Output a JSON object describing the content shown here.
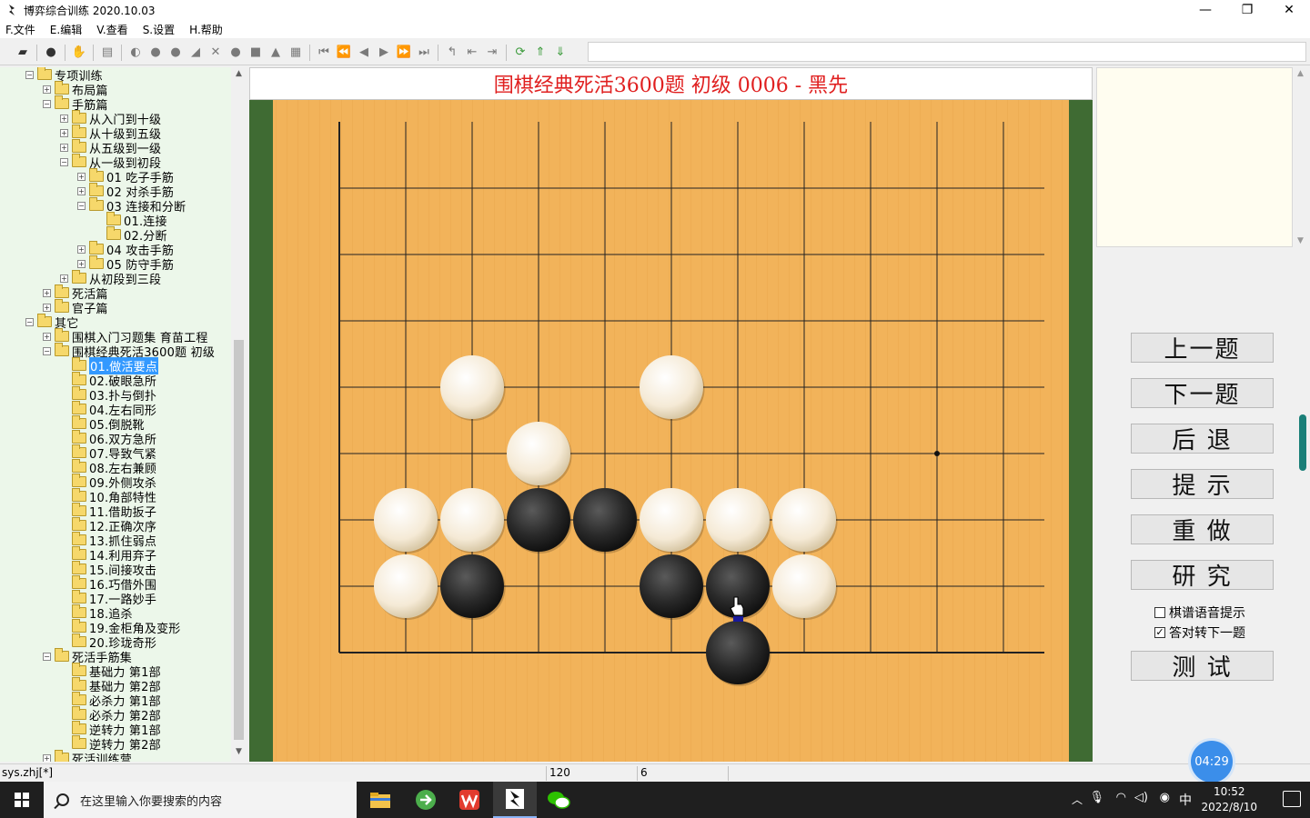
{
  "window": {
    "title": "博弈综合训练 2020.10.03",
    "controls": [
      "—",
      "❐",
      "✕"
    ]
  },
  "menu": [
    "F.文件",
    "E.编辑",
    "V.查看",
    "S.设置",
    "H.帮助"
  ],
  "tree": [
    {
      "indent": 0,
      "exp": "−",
      "label": "专项训练",
      "sel": false
    },
    {
      "indent": 1,
      "exp": "+",
      "label": "布局篇",
      "sel": false
    },
    {
      "indent": 1,
      "exp": "−",
      "label": "手筋篇",
      "sel": false
    },
    {
      "indent": 2,
      "exp": "+",
      "label": "从入门到十级",
      "sel": false
    },
    {
      "indent": 2,
      "exp": "+",
      "label": "从十级到五级",
      "sel": false
    },
    {
      "indent": 2,
      "exp": "+",
      "label": "从五级到一级",
      "sel": false
    },
    {
      "indent": 2,
      "exp": "−",
      "label": "从一级到初段",
      "sel": false
    },
    {
      "indent": 3,
      "exp": "+",
      "label": "01 吃子手筋",
      "sel": false
    },
    {
      "indent": 3,
      "exp": "+",
      "label": "02 对杀手筋",
      "sel": false
    },
    {
      "indent": 3,
      "exp": "−",
      "label": "03 连接和分断",
      "sel": false
    },
    {
      "indent": 4,
      "exp": "",
      "label": "01.连接",
      "sel": false
    },
    {
      "indent": 4,
      "exp": "",
      "label": "02.分断",
      "sel": false
    },
    {
      "indent": 3,
      "exp": "+",
      "label": "04 攻击手筋",
      "sel": false
    },
    {
      "indent": 3,
      "exp": "+",
      "label": "05 防守手筋",
      "sel": false
    },
    {
      "indent": 2,
      "exp": "+",
      "label": "从初段到三段",
      "sel": false
    },
    {
      "indent": 1,
      "exp": "+",
      "label": "死活篇",
      "sel": false
    },
    {
      "indent": 1,
      "exp": "+",
      "label": "官子篇",
      "sel": false
    },
    {
      "indent": 0,
      "exp": "−",
      "label": "其它",
      "sel": false
    },
    {
      "indent": 1,
      "exp": "+",
      "label": "围棋入门习题集 育苗工程",
      "sel": false
    },
    {
      "indent": 1,
      "exp": "−",
      "label": "围棋经典死活3600题 初级",
      "sel": false
    },
    {
      "indent": 2,
      "exp": "",
      "label": "01.做活要点",
      "sel": true
    },
    {
      "indent": 2,
      "exp": "",
      "label": "02.破眼急所",
      "sel": false
    },
    {
      "indent": 2,
      "exp": "",
      "label": "03.扑与倒扑",
      "sel": false
    },
    {
      "indent": 2,
      "exp": "",
      "label": "04.左右同形",
      "sel": false
    },
    {
      "indent": 2,
      "exp": "",
      "label": "05.倒脱靴",
      "sel": false
    },
    {
      "indent": 2,
      "exp": "",
      "label": "06.双方急所",
      "sel": false
    },
    {
      "indent": 2,
      "exp": "",
      "label": "07.导致气紧",
      "sel": false
    },
    {
      "indent": 2,
      "exp": "",
      "label": "08.左右兼顾",
      "sel": false
    },
    {
      "indent": 2,
      "exp": "",
      "label": "09.外侧攻杀",
      "sel": false
    },
    {
      "indent": 2,
      "exp": "",
      "label": "10.角部特性",
      "sel": false
    },
    {
      "indent": 2,
      "exp": "",
      "label": "11.借助扳子",
      "sel": false
    },
    {
      "indent": 2,
      "exp": "",
      "label": "12.正确次序",
      "sel": false
    },
    {
      "indent": 2,
      "exp": "",
      "label": "13.抓住弱点",
      "sel": false
    },
    {
      "indent": 2,
      "exp": "",
      "label": "14.利用弃子",
      "sel": false
    },
    {
      "indent": 2,
      "exp": "",
      "label": "15.间接攻击",
      "sel": false
    },
    {
      "indent": 2,
      "exp": "",
      "label": "16.巧借外围",
      "sel": false
    },
    {
      "indent": 2,
      "exp": "",
      "label": "17.一路妙手",
      "sel": false
    },
    {
      "indent": 2,
      "exp": "",
      "label": "18.追杀",
      "sel": false
    },
    {
      "indent": 2,
      "exp": "",
      "label": "19.金柜角及变形",
      "sel": false
    },
    {
      "indent": 2,
      "exp": "",
      "label": "20.珍珑奇形",
      "sel": false
    },
    {
      "indent": 1,
      "exp": "−",
      "label": "死活手筋集",
      "sel": false
    },
    {
      "indent": 2,
      "exp": "",
      "label": "基础力 第1部",
      "sel": false
    },
    {
      "indent": 2,
      "exp": "",
      "label": "基础力 第2部",
      "sel": false
    },
    {
      "indent": 2,
      "exp": "",
      "label": "必杀力 第1部",
      "sel": false
    },
    {
      "indent": 2,
      "exp": "",
      "label": "必杀力 第2部",
      "sel": false
    },
    {
      "indent": 2,
      "exp": "",
      "label": "逆转力 第1部",
      "sel": false
    },
    {
      "indent": 2,
      "exp": "",
      "label": "逆转力 第2部",
      "sel": false
    },
    {
      "indent": 1,
      "exp": "+",
      "label": "死活训练营",
      "sel": false
    }
  ],
  "board": {
    "title": "围棋经典死活3600题 初级 0006 - 黑先",
    "columns": 11,
    "rows": 9,
    "stones": [
      {
        "col": 2,
        "row": 4,
        "color": "white"
      },
      {
        "col": 5,
        "row": 4,
        "color": "white"
      },
      {
        "col": 3,
        "row": 5,
        "color": "white"
      },
      {
        "col": 1,
        "row": 6,
        "color": "white"
      },
      {
        "col": 2,
        "row": 6,
        "color": "white"
      },
      {
        "col": 3,
        "row": 6,
        "color": "black"
      },
      {
        "col": 4,
        "row": 6,
        "color": "black"
      },
      {
        "col": 5,
        "row": 6,
        "color": "white"
      },
      {
        "col": 6,
        "row": 6,
        "color": "white"
      },
      {
        "col": 7,
        "row": 6,
        "color": "white"
      },
      {
        "col": 1,
        "row": 7,
        "color": "white"
      },
      {
        "col": 2,
        "row": 7,
        "color": "black"
      },
      {
        "col": 5,
        "row": 7,
        "color": "black"
      },
      {
        "col": 6,
        "row": 7,
        "color": "black"
      },
      {
        "col": 7,
        "row": 7,
        "color": "white"
      },
      {
        "col": 6,
        "row": 8,
        "color": "black"
      }
    ],
    "star": {
      "col": 9,
      "row": 5
    }
  },
  "buttons": {
    "prev": "上一题",
    "next": "下一题",
    "back": "后 退",
    "hint": "提 示",
    "redo": "重 做",
    "study": "研 究",
    "test": "测 试"
  },
  "checkboxes": {
    "voice": {
      "label": "棋谱语音提示",
      "checked": false
    },
    "auto_next": {
      "label": "答对转下一题",
      "checked": true
    }
  },
  "status": {
    "file": "sys.zhj[*]",
    "count": "120",
    "num": "6"
  },
  "timer": "04:29",
  "taskbar": {
    "search_placeholder": "在这里输入你要搜索的内容",
    "ime": "中",
    "time": "10:52",
    "date": "2022/8/10"
  },
  "colors": {
    "board": "#f2b35a",
    "board_border": "#3f6b33",
    "title_red": "#e02020",
    "selection": "#3399ff",
    "tree_bg": "#ecf7ea"
  }
}
